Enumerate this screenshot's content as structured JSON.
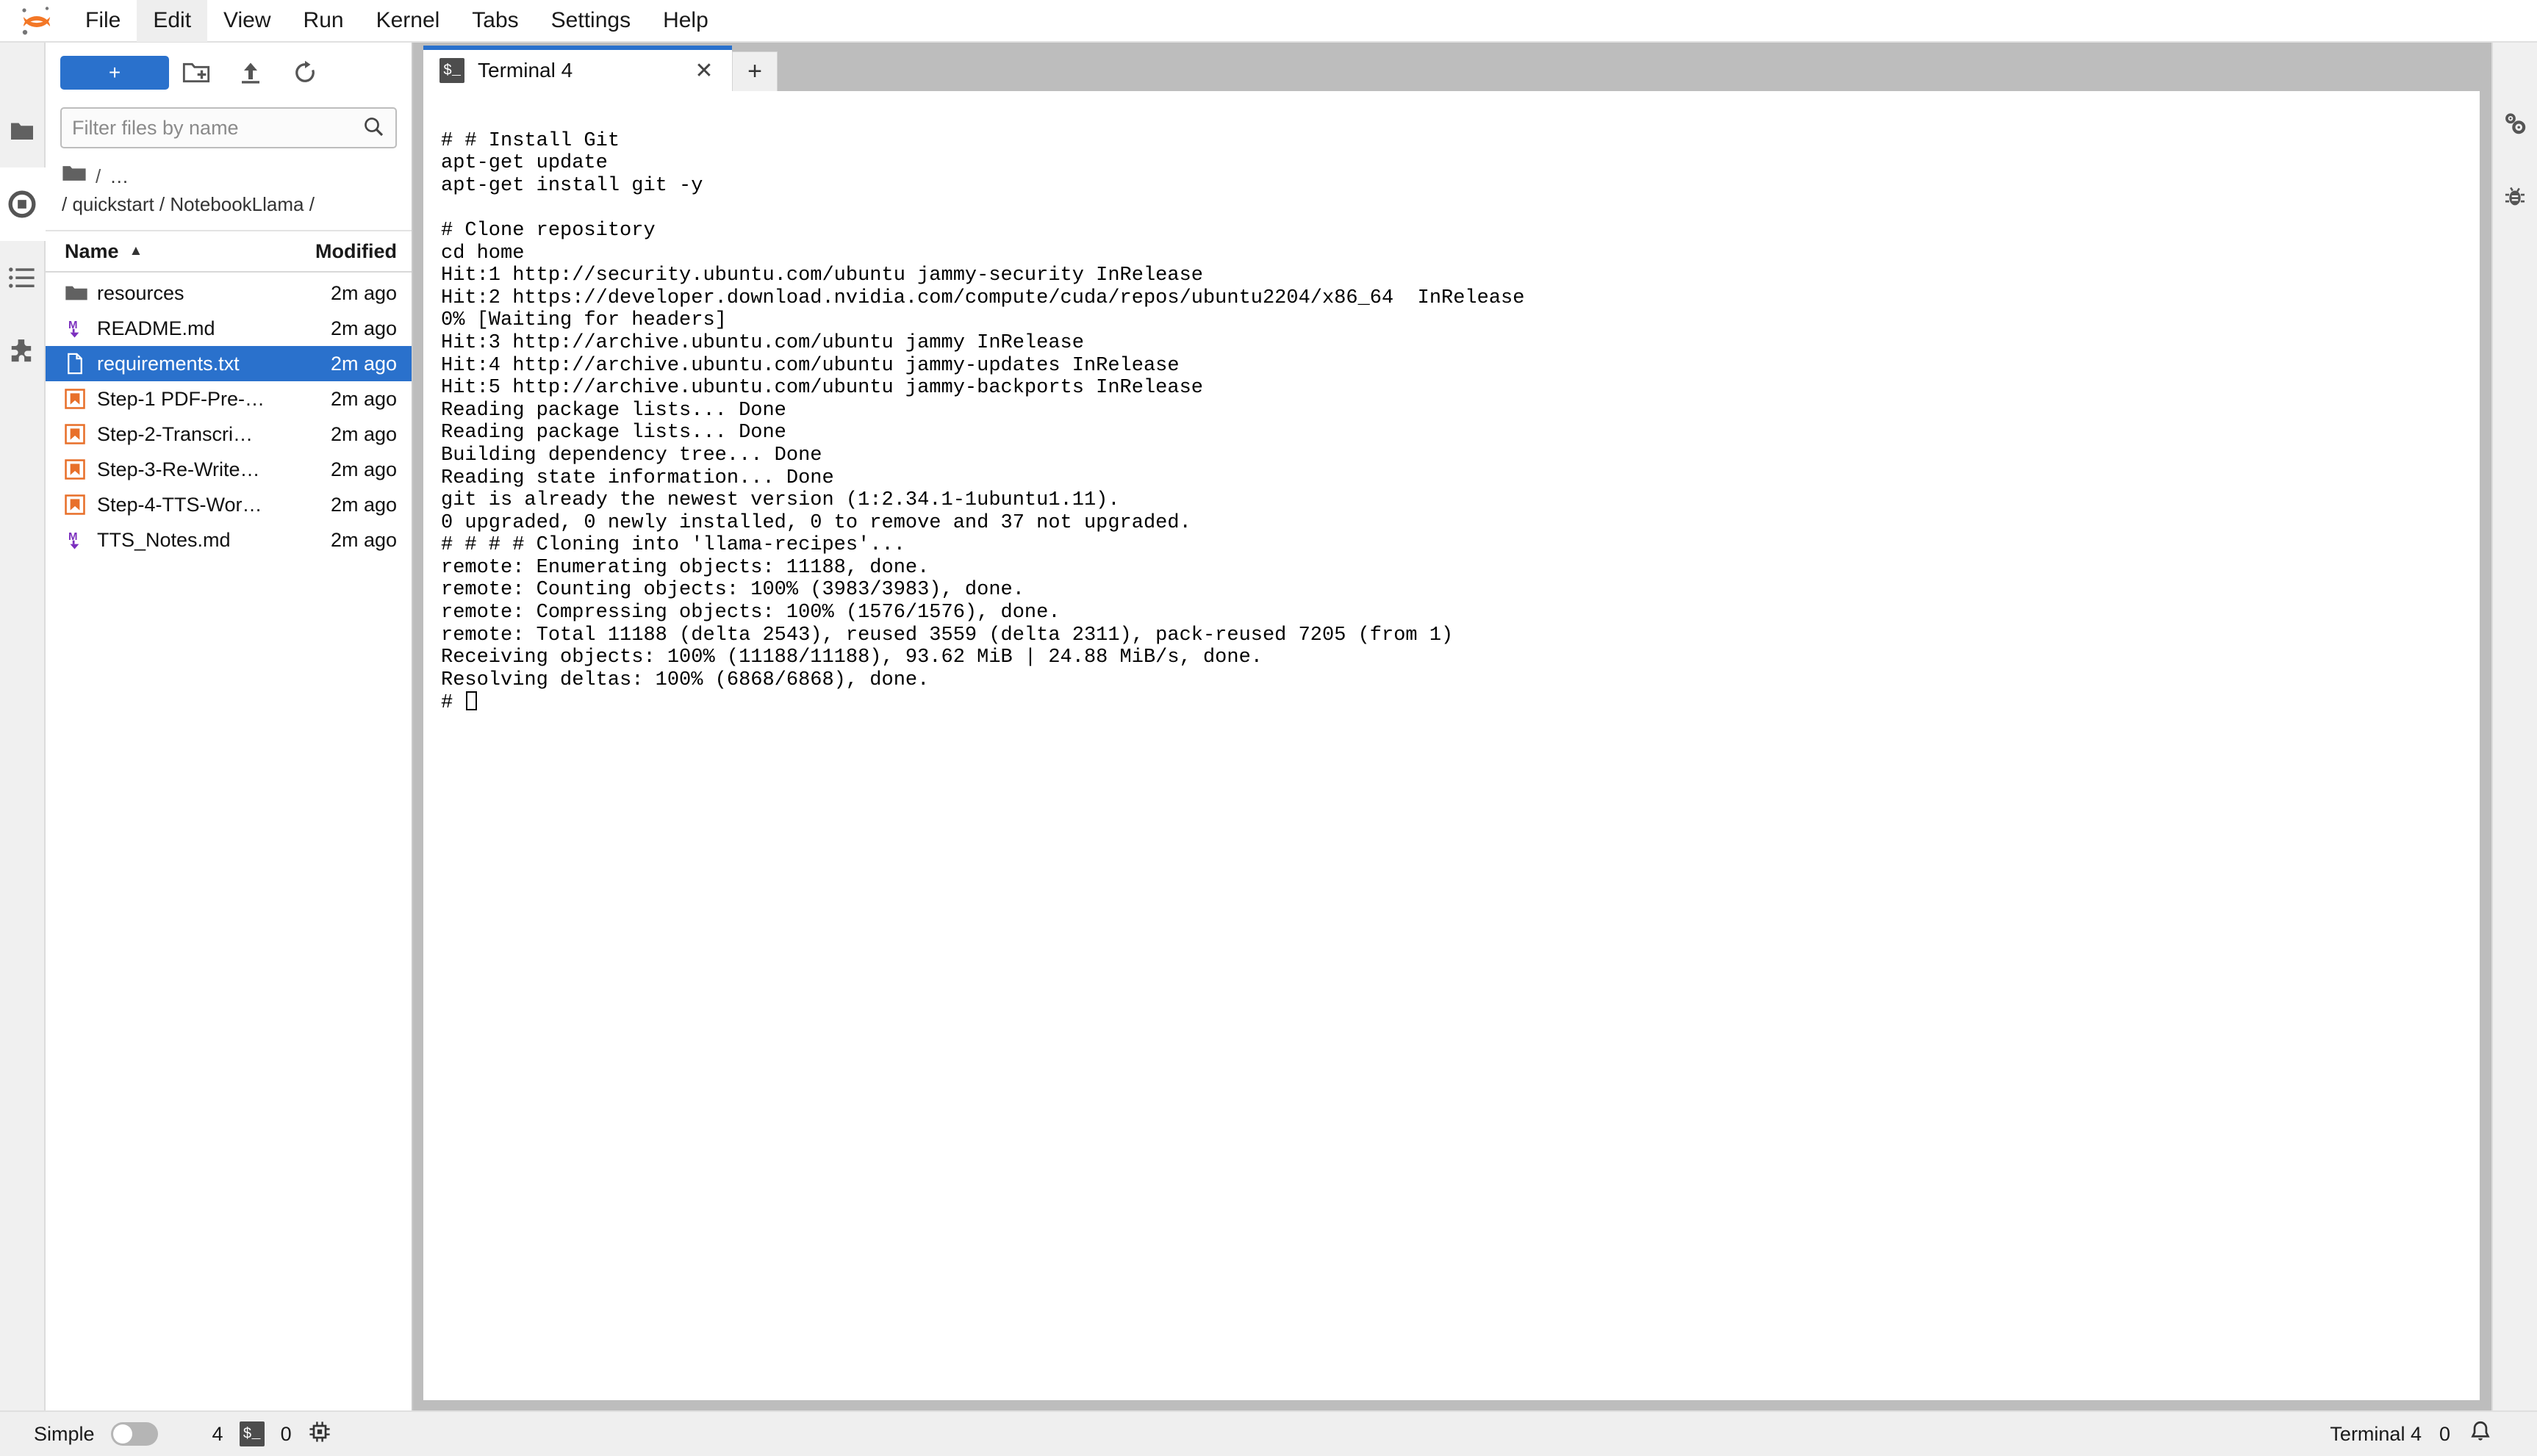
{
  "app": {
    "logo_icon": "jupyter-logo-icon"
  },
  "menubar": {
    "items": [
      {
        "label": "File",
        "active": false
      },
      {
        "label": "Edit",
        "active": true
      },
      {
        "label": "View",
        "active": false
      },
      {
        "label": "Run",
        "active": false
      },
      {
        "label": "Kernel",
        "active": false
      },
      {
        "label": "Tabs",
        "active": false
      },
      {
        "label": "Settings",
        "active": false
      },
      {
        "label": "Help",
        "active": false
      }
    ]
  },
  "left_activity_bar": {
    "items": [
      {
        "name": "file-browser-icon",
        "selected": false
      },
      {
        "name": "running-terminals-icon",
        "selected": true
      },
      {
        "name": "table-of-contents-icon",
        "selected": false
      },
      {
        "name": "extension-manager-icon",
        "selected": false
      }
    ]
  },
  "right_activity_bar": {
    "items": [
      {
        "name": "property-inspector-icon"
      },
      {
        "name": "debugger-icon"
      }
    ]
  },
  "file_browser": {
    "new_launcher_label": "+",
    "toolbar_buttons": [
      {
        "name": "new-folder-button",
        "label": ""
      },
      {
        "name": "upload-button",
        "label": ""
      },
      {
        "name": "refresh-button",
        "label": ""
      }
    ],
    "filter": {
      "value": "",
      "placeholder": "Filter files by name",
      "search_icon": "search-icon"
    },
    "breadcrumbs": {
      "root_icon": "folder-icon",
      "sep": "/",
      "ellipsis": "…",
      "path": "/ quickstart / NotebookLlama /"
    },
    "columns": {
      "name": "Name",
      "modified": "Modified",
      "sort_caret": "▲"
    },
    "files": [
      {
        "name": "resources",
        "modified": "2m ago",
        "icon": "folder-icon",
        "selected": false
      },
      {
        "name": "README.md",
        "modified": "2m ago",
        "icon": "markdown-icon",
        "selected": false
      },
      {
        "name": "requirements.txt",
        "modified": "2m ago",
        "icon": "text-file-icon",
        "selected": true
      },
      {
        "name": "Step-1 PDF-Pre-…",
        "modified": "2m ago",
        "icon": "notebook-icon",
        "selected": false
      },
      {
        "name": "Step-2-Transcri…",
        "modified": "2m ago",
        "icon": "notebook-icon",
        "selected": false
      },
      {
        "name": "Step-3-Re-Write…",
        "modified": "2m ago",
        "icon": "notebook-icon",
        "selected": false
      },
      {
        "name": "Step-4-TTS-Wor…",
        "modified": "2m ago",
        "icon": "notebook-icon",
        "selected": false
      },
      {
        "name": "TTS_Notes.md",
        "modified": "2m ago",
        "icon": "markdown-icon",
        "selected": false
      }
    ]
  },
  "dock": {
    "tabs": [
      {
        "label": "Terminal 4",
        "icon": "terminal-icon",
        "close_icon": "close-icon",
        "active": true
      }
    ],
    "add_tab_label": "+"
  },
  "terminal": {
    "lines": [
      "# # Install Git",
      "apt-get update",
      "apt-get install git -y",
      "",
      "# Clone repository",
      "cd home",
      "Hit:1 http://security.ubuntu.com/ubuntu jammy-security InRelease",
      "Hit:2 https://developer.download.nvidia.com/compute/cuda/repos/ubuntu2204/x86_64  InRelease",
      "0% [Waiting for headers]",
      "Hit:3 http://archive.ubuntu.com/ubuntu jammy InRelease",
      "Hit:4 http://archive.ubuntu.com/ubuntu jammy-updates InRelease",
      "Hit:5 http://archive.ubuntu.com/ubuntu jammy-backports InRelease",
      "Reading package lists... Done",
      "Reading package lists... Done",
      "Building dependency tree... Done",
      "Reading state information... Done",
      "git is already the newest version (1:2.34.1-1ubuntu1.11).",
      "0 upgraded, 0 newly installed, 0 to remove and 37 not upgraded.",
      "# # # # Cloning into 'llama-recipes'...",
      "remote: Enumerating objects: 11188, done.",
      "remote: Counting objects: 100% (3983/3983), done.",
      "remote: Compressing objects: 100% (1576/1576), done.",
      "remote: Total 11188 (delta 2543), reused 3559 (delta 2311), pack-reused 7205 (from 1)",
      "Receiving objects: 100% (11188/11188), 93.62 MiB | 24.88 MiB/s, done.",
      "Resolving deltas: 100% (6868/6868), done."
    ],
    "prompt": "# "
  },
  "statusbar": {
    "mode_label": "Simple",
    "mode_enabled": false,
    "kernel_count": "4",
    "terminal_icon": "terminal-icon",
    "terminal_count": "0",
    "memory_icon": "cpu-icon",
    "active_tab": "Terminal 4",
    "notification_count": "0",
    "notification_icon": "bell-icon"
  },
  "colors": {
    "accent": "#2a71cc",
    "logo_orange": "#f37726",
    "markdown_purple": "#7b2fbe",
    "notebook_orange": "#e8702a",
    "dock_gray": "#bdbdbd",
    "panel_gray": "#f0f0f0"
  }
}
